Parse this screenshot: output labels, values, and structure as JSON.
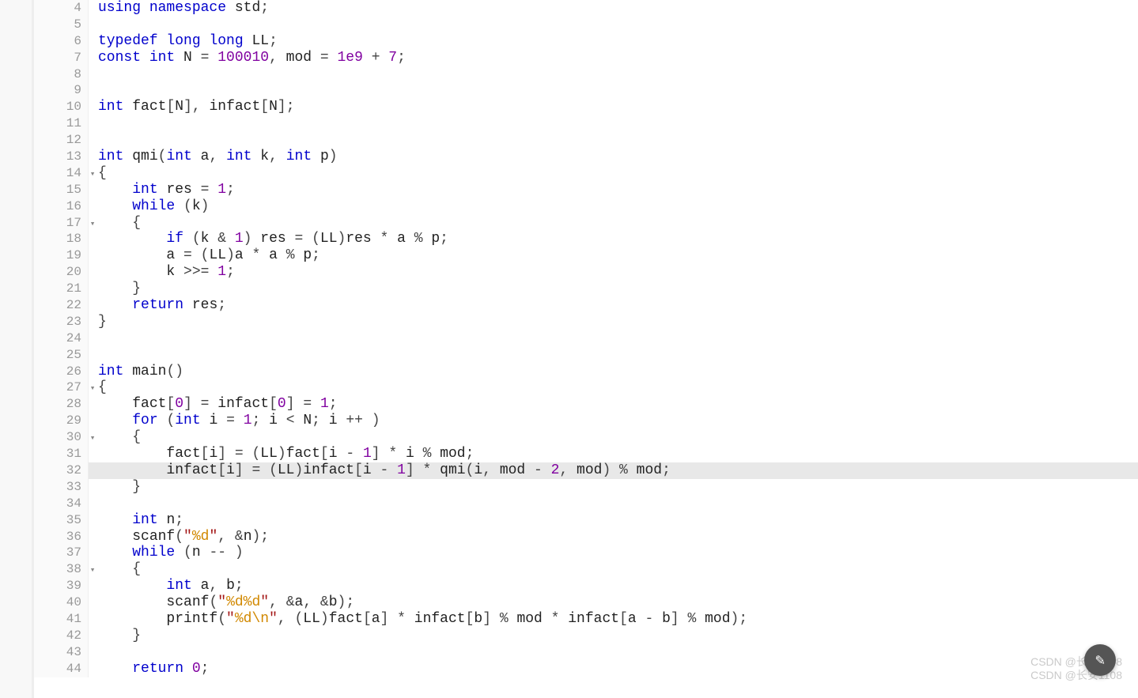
{
  "watermark_line1": "CSDN @长安1108",
  "watermark_line2": "CSDN @长安1108",
  "scroll_top_glyph": "✎",
  "lines": [
    {
      "n": 4,
      "fold": "",
      "hl": false,
      "tokens": [
        [
          "kw",
          "using "
        ],
        [
          "kw",
          "namespace "
        ],
        [
          "id",
          "std"
        ],
        [
          "op",
          ";"
        ]
      ]
    },
    {
      "n": 5,
      "fold": "",
      "hl": false,
      "tokens": []
    },
    {
      "n": 6,
      "fold": "",
      "hl": false,
      "tokens": [
        [
          "kw",
          "typedef "
        ],
        [
          "kw",
          "long "
        ],
        [
          "kw",
          "long "
        ],
        [
          "id",
          "LL"
        ],
        [
          "op",
          ";"
        ]
      ]
    },
    {
      "n": 7,
      "fold": "",
      "hl": false,
      "tokens": [
        [
          "kw",
          "const "
        ],
        [
          "kw",
          "int "
        ],
        [
          "id",
          "N"
        ],
        [
          "op",
          " = "
        ],
        [
          "num",
          "100010"
        ],
        [
          "op",
          ", "
        ],
        [
          "id",
          "mod"
        ],
        [
          "op",
          " = "
        ],
        [
          "num",
          "1e9"
        ],
        [
          "op",
          " + "
        ],
        [
          "num",
          "7"
        ],
        [
          "op",
          ";"
        ]
      ]
    },
    {
      "n": 8,
      "fold": "",
      "hl": false,
      "tokens": []
    },
    {
      "n": 9,
      "fold": "",
      "hl": false,
      "tokens": []
    },
    {
      "n": 10,
      "fold": "",
      "hl": false,
      "tokens": [
        [
          "kw",
          "int "
        ],
        [
          "id",
          "fact"
        ],
        [
          "op",
          "["
        ],
        [
          "id",
          "N"
        ],
        [
          "op",
          "], "
        ],
        [
          "id",
          "infact"
        ],
        [
          "op",
          "["
        ],
        [
          "id",
          "N"
        ],
        [
          "op",
          "];"
        ]
      ]
    },
    {
      "n": 11,
      "fold": "",
      "hl": false,
      "tokens": []
    },
    {
      "n": 12,
      "fold": "",
      "hl": false,
      "tokens": []
    },
    {
      "n": 13,
      "fold": "",
      "hl": false,
      "tokens": [
        [
          "kw",
          "int "
        ],
        [
          "id",
          "qmi"
        ],
        [
          "op",
          "("
        ],
        [
          "kw",
          "int "
        ],
        [
          "id",
          "a"
        ],
        [
          "op",
          ", "
        ],
        [
          "kw",
          "int "
        ],
        [
          "id",
          "k"
        ],
        [
          "op",
          ", "
        ],
        [
          "kw",
          "int "
        ],
        [
          "id",
          "p"
        ],
        [
          "op",
          ")"
        ]
      ]
    },
    {
      "n": 14,
      "fold": "▾",
      "hl": false,
      "tokens": [
        [
          "op",
          "{"
        ]
      ]
    },
    {
      "n": 15,
      "fold": "",
      "hl": false,
      "tokens": [
        [
          "op",
          "    "
        ],
        [
          "kw",
          "int "
        ],
        [
          "id",
          "res"
        ],
        [
          "op",
          " = "
        ],
        [
          "num",
          "1"
        ],
        [
          "op",
          ";"
        ]
      ]
    },
    {
      "n": 16,
      "fold": "",
      "hl": false,
      "tokens": [
        [
          "op",
          "    "
        ],
        [
          "kw",
          "while "
        ],
        [
          "op",
          "("
        ],
        [
          "id",
          "k"
        ],
        [
          "op",
          ")"
        ]
      ]
    },
    {
      "n": 17,
      "fold": "▾",
      "hl": false,
      "tokens": [
        [
          "op",
          "    {"
        ]
      ]
    },
    {
      "n": 18,
      "fold": "",
      "hl": false,
      "tokens": [
        [
          "op",
          "        "
        ],
        [
          "kw",
          "if "
        ],
        [
          "op",
          "("
        ],
        [
          "id",
          "k"
        ],
        [
          "op",
          " & "
        ],
        [
          "num",
          "1"
        ],
        [
          "op",
          ") "
        ],
        [
          "id",
          "res"
        ],
        [
          "op",
          " = ("
        ],
        [
          "id",
          "LL"
        ],
        [
          "op",
          ")"
        ],
        [
          "id",
          "res"
        ],
        [
          "op",
          " * "
        ],
        [
          "id",
          "a"
        ],
        [
          "op",
          " % "
        ],
        [
          "id",
          "p"
        ],
        [
          "op",
          ";"
        ]
      ]
    },
    {
      "n": 19,
      "fold": "",
      "hl": false,
      "tokens": [
        [
          "op",
          "        "
        ],
        [
          "id",
          "a"
        ],
        [
          "op",
          " = ("
        ],
        [
          "id",
          "LL"
        ],
        [
          "op",
          ")"
        ],
        [
          "id",
          "a"
        ],
        [
          "op",
          " * "
        ],
        [
          "id",
          "a"
        ],
        [
          "op",
          " % "
        ],
        [
          "id",
          "p"
        ],
        [
          "op",
          ";"
        ]
      ]
    },
    {
      "n": 20,
      "fold": "",
      "hl": false,
      "tokens": [
        [
          "op",
          "        "
        ],
        [
          "id",
          "k"
        ],
        [
          "op",
          " >>= "
        ],
        [
          "num",
          "1"
        ],
        [
          "op",
          ";"
        ]
      ]
    },
    {
      "n": 21,
      "fold": "",
      "hl": false,
      "tokens": [
        [
          "op",
          "    }"
        ]
      ]
    },
    {
      "n": 22,
      "fold": "",
      "hl": false,
      "tokens": [
        [
          "op",
          "    "
        ],
        [
          "kw",
          "return "
        ],
        [
          "id",
          "res"
        ],
        [
          "op",
          ";"
        ]
      ]
    },
    {
      "n": 23,
      "fold": "",
      "hl": false,
      "tokens": [
        [
          "op",
          "}"
        ]
      ]
    },
    {
      "n": 24,
      "fold": "",
      "hl": false,
      "tokens": []
    },
    {
      "n": 25,
      "fold": "",
      "hl": false,
      "tokens": []
    },
    {
      "n": 26,
      "fold": "",
      "hl": false,
      "tokens": [
        [
          "kw",
          "int "
        ],
        [
          "id",
          "main"
        ],
        [
          "op",
          "()"
        ]
      ]
    },
    {
      "n": 27,
      "fold": "▾",
      "hl": false,
      "tokens": [
        [
          "op",
          "{"
        ]
      ]
    },
    {
      "n": 28,
      "fold": "",
      "hl": false,
      "tokens": [
        [
          "op",
          "    "
        ],
        [
          "id",
          "fact"
        ],
        [
          "op",
          "["
        ],
        [
          "num",
          "0"
        ],
        [
          "op",
          "] = "
        ],
        [
          "id",
          "infact"
        ],
        [
          "op",
          "["
        ],
        [
          "num",
          "0"
        ],
        [
          "op",
          "] = "
        ],
        [
          "num",
          "1"
        ],
        [
          "op",
          ";"
        ]
      ]
    },
    {
      "n": 29,
      "fold": "",
      "hl": false,
      "tokens": [
        [
          "op",
          "    "
        ],
        [
          "kw",
          "for "
        ],
        [
          "op",
          "("
        ],
        [
          "kw",
          "int "
        ],
        [
          "id",
          "i"
        ],
        [
          "op",
          " = "
        ],
        [
          "num",
          "1"
        ],
        [
          "op",
          "; "
        ],
        [
          "id",
          "i"
        ],
        [
          "op",
          " < "
        ],
        [
          "id",
          "N"
        ],
        [
          "op",
          "; "
        ],
        [
          "id",
          "i"
        ],
        [
          "op",
          " ++ )"
        ]
      ]
    },
    {
      "n": 30,
      "fold": "▾",
      "hl": false,
      "tokens": [
        [
          "op",
          "    {"
        ]
      ]
    },
    {
      "n": 31,
      "fold": "",
      "hl": false,
      "tokens": [
        [
          "op",
          "        "
        ],
        [
          "id",
          "fact"
        ],
        [
          "op",
          "["
        ],
        [
          "id",
          "i"
        ],
        [
          "op",
          "] = ("
        ],
        [
          "id",
          "LL"
        ],
        [
          "op",
          ")"
        ],
        [
          "id",
          "fact"
        ],
        [
          "op",
          "["
        ],
        [
          "id",
          "i"
        ],
        [
          "op",
          " - "
        ],
        [
          "num",
          "1"
        ],
        [
          "op",
          "] * "
        ],
        [
          "id",
          "i"
        ],
        [
          "op",
          " % "
        ],
        [
          "id",
          "mod"
        ],
        [
          "op",
          ";"
        ]
      ]
    },
    {
      "n": 32,
      "fold": "",
      "hl": true,
      "tokens": [
        [
          "op",
          "        "
        ],
        [
          "id",
          "infact"
        ],
        [
          "op",
          "["
        ],
        [
          "id",
          "i"
        ],
        [
          "op",
          "] = ("
        ],
        [
          "id",
          "LL"
        ],
        [
          "op",
          ")"
        ],
        [
          "id",
          "infact"
        ],
        [
          "op",
          "["
        ],
        [
          "id",
          "i"
        ],
        [
          "op",
          " - "
        ],
        [
          "num",
          "1"
        ],
        [
          "op",
          "] * "
        ],
        [
          "id",
          "qmi"
        ],
        [
          "op",
          "("
        ],
        [
          "id",
          "i"
        ],
        [
          "op",
          ", "
        ],
        [
          "id",
          "mod"
        ],
        [
          "op",
          " - "
        ],
        [
          "num",
          "2"
        ],
        [
          "op",
          ", "
        ],
        [
          "id",
          "mod"
        ],
        [
          "op",
          ") % "
        ],
        [
          "id",
          "mod"
        ],
        [
          "op",
          ";"
        ]
      ]
    },
    {
      "n": 33,
      "fold": "",
      "hl": false,
      "tokens": [
        [
          "op",
          "    }"
        ]
      ]
    },
    {
      "n": 34,
      "fold": "",
      "hl": false,
      "tokens": []
    },
    {
      "n": 35,
      "fold": "",
      "hl": false,
      "tokens": [
        [
          "op",
          "    "
        ],
        [
          "kw",
          "int "
        ],
        [
          "id",
          "n"
        ],
        [
          "op",
          ";"
        ]
      ]
    },
    {
      "n": 36,
      "fold": "",
      "hl": false,
      "tokens": [
        [
          "op",
          "    "
        ],
        [
          "id",
          "scanf"
        ],
        [
          "op",
          "("
        ],
        [
          "str",
          "\""
        ],
        [
          "fmt",
          "%d"
        ],
        [
          "str",
          "\""
        ],
        [
          "op",
          ", &"
        ],
        [
          "id",
          "n"
        ],
        [
          "op",
          ");"
        ]
      ]
    },
    {
      "n": 37,
      "fold": "",
      "hl": false,
      "tokens": [
        [
          "op",
          "    "
        ],
        [
          "kw",
          "while "
        ],
        [
          "op",
          "("
        ],
        [
          "id",
          "n"
        ],
        [
          "op",
          " -- )"
        ]
      ]
    },
    {
      "n": 38,
      "fold": "▾",
      "hl": false,
      "tokens": [
        [
          "op",
          "    {"
        ]
      ]
    },
    {
      "n": 39,
      "fold": "",
      "hl": false,
      "tokens": [
        [
          "op",
          "        "
        ],
        [
          "kw",
          "int "
        ],
        [
          "id",
          "a"
        ],
        [
          "op",
          ", "
        ],
        [
          "id",
          "b"
        ],
        [
          "op",
          ";"
        ]
      ]
    },
    {
      "n": 40,
      "fold": "",
      "hl": false,
      "tokens": [
        [
          "op",
          "        "
        ],
        [
          "id",
          "scanf"
        ],
        [
          "op",
          "("
        ],
        [
          "str",
          "\""
        ],
        [
          "fmt",
          "%d%d"
        ],
        [
          "str",
          "\""
        ],
        [
          "op",
          ", &"
        ],
        [
          "id",
          "a"
        ],
        [
          "op",
          ", &"
        ],
        [
          "id",
          "b"
        ],
        [
          "op",
          ");"
        ]
      ]
    },
    {
      "n": 41,
      "fold": "",
      "hl": false,
      "tokens": [
        [
          "op",
          "        "
        ],
        [
          "id",
          "printf"
        ],
        [
          "op",
          "("
        ],
        [
          "str",
          "\""
        ],
        [
          "fmt",
          "%d"
        ],
        [
          "esc",
          "\\n"
        ],
        [
          "str",
          "\""
        ],
        [
          "op",
          ", ("
        ],
        [
          "id",
          "LL"
        ],
        [
          "op",
          ")"
        ],
        [
          "id",
          "fact"
        ],
        [
          "op",
          "["
        ],
        [
          "id",
          "a"
        ],
        [
          "op",
          "] * "
        ],
        [
          "id",
          "infact"
        ],
        [
          "op",
          "["
        ],
        [
          "id",
          "b"
        ],
        [
          "op",
          "] % "
        ],
        [
          "id",
          "mod"
        ],
        [
          "op",
          " * "
        ],
        [
          "id",
          "infact"
        ],
        [
          "op",
          "["
        ],
        [
          "id",
          "a"
        ],
        [
          "op",
          " - "
        ],
        [
          "id",
          "b"
        ],
        [
          "op",
          "] % "
        ],
        [
          "id",
          "mod"
        ],
        [
          "op",
          ");"
        ]
      ]
    },
    {
      "n": 42,
      "fold": "",
      "hl": false,
      "tokens": [
        [
          "op",
          "    }"
        ]
      ]
    },
    {
      "n": 43,
      "fold": "",
      "hl": false,
      "tokens": []
    },
    {
      "n": 44,
      "fold": "",
      "hl": false,
      "tokens": [
        [
          "op",
          "    "
        ],
        [
          "kw",
          "return "
        ],
        [
          "num",
          "0"
        ],
        [
          "op",
          ";"
        ]
      ]
    }
  ]
}
